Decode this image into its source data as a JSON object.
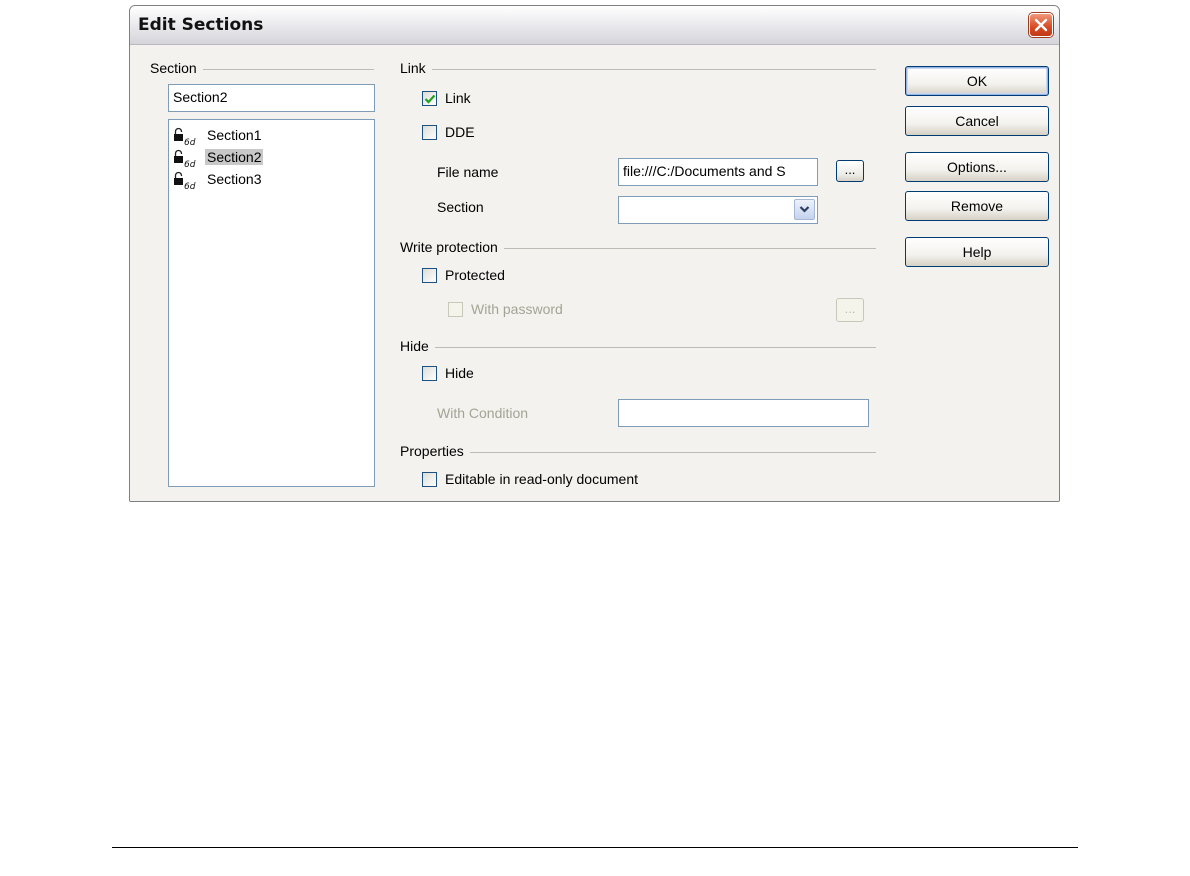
{
  "dialog": {
    "title": "Edit Sections",
    "close_icon": "close-icon"
  },
  "section_panel": {
    "group_label": "Section",
    "name_value": "Section2",
    "items": [
      {
        "label": "Section1",
        "icon": "lock-link-icon",
        "selected": false
      },
      {
        "label": "Section2",
        "icon": "lock-link-icon",
        "selected": true
      },
      {
        "label": "Section3",
        "icon": "lock-link-icon",
        "selected": false
      }
    ]
  },
  "link": {
    "group_label": "Link",
    "link_checkbox": {
      "label": "Link",
      "checked": true
    },
    "dde_checkbox": {
      "label": "DDE",
      "checked": false
    },
    "file_name_label": "File name",
    "file_name_value": "file:///C:/Documents and S",
    "browse_label": "...",
    "section_label": "Section",
    "section_value": ""
  },
  "write_protection": {
    "group_label": "Write protection",
    "protected_checkbox": {
      "label": "Protected",
      "checked": false
    },
    "password_checkbox": {
      "label": "With password",
      "checked": false,
      "enabled": false
    },
    "password_button_label": "..."
  },
  "hide": {
    "group_label": "Hide",
    "hide_checkbox": {
      "label": "Hide",
      "checked": false
    },
    "condition_label": "With Condition",
    "condition_value": ""
  },
  "properties": {
    "group_label": "Properties",
    "editable_checkbox": {
      "label": "Editable in read-only document",
      "checked": false
    }
  },
  "buttons": {
    "ok": "OK",
    "cancel": "Cancel",
    "options": "Options...",
    "remove": "Remove",
    "help": "Help"
  },
  "colors": {
    "dialog_background": "#f3f2ee",
    "title_bar": "#e8e8ec",
    "close_button": "#d64a24",
    "selection": "#c8c8c8",
    "check_mark": "#21a121"
  }
}
